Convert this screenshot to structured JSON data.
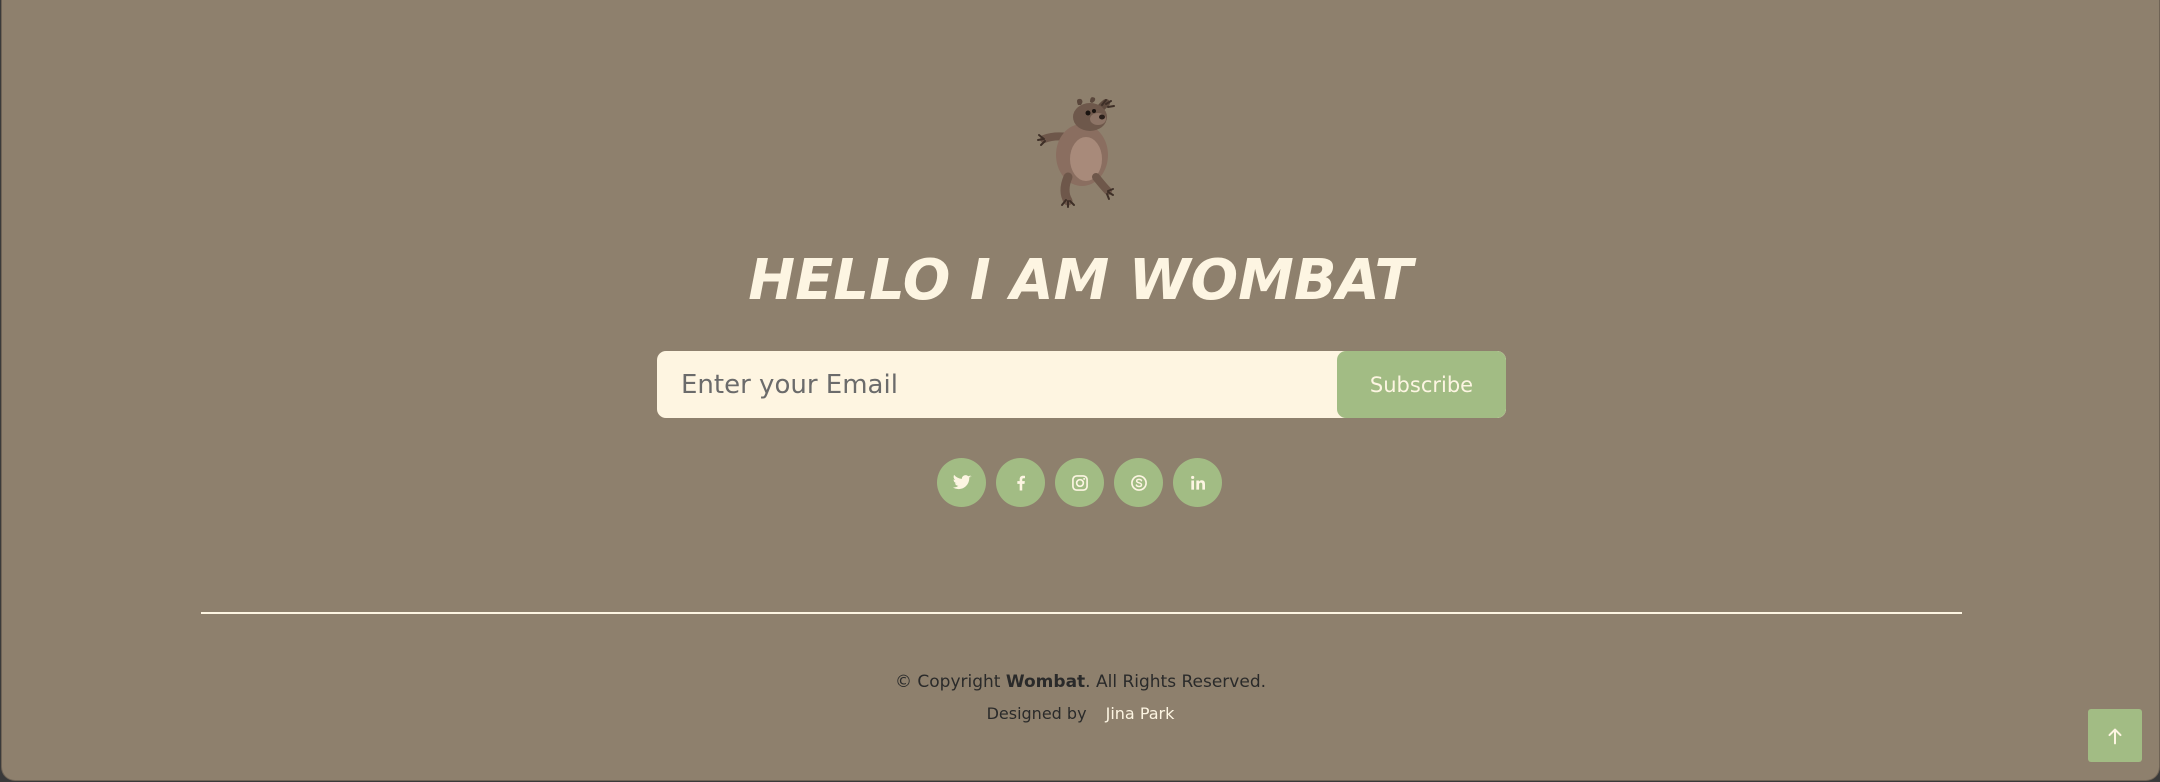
{
  "hero": {
    "title": "HELLO I AM WOMBAT",
    "logo_icon": "wombat-mascot-icon"
  },
  "newsletter": {
    "email_placeholder": "Enter your Email",
    "email_value": "",
    "button_label": "Subscribe"
  },
  "socials": [
    {
      "name": "twitter",
      "icon": "twitter-icon"
    },
    {
      "name": "facebook",
      "icon": "facebook-icon"
    },
    {
      "name": "instagram",
      "icon": "instagram-icon"
    },
    {
      "name": "skype",
      "icon": "skype-icon"
    },
    {
      "name": "linkedin",
      "icon": "linkedin-icon"
    }
  ],
  "footer": {
    "copyright_prefix": "© Copyright ",
    "brand": "Wombat",
    "copyright_suffix": ". All Rights Reserved.",
    "designed_by_label": "Designed by",
    "designer": "Jina Park"
  },
  "back_to_top": {
    "icon": "arrow-up-icon"
  },
  "colors": {
    "background": "#8e806d",
    "accent": "#a2bc84",
    "cream": "#fdf5e2",
    "text_dark": "#2a2a2a"
  }
}
